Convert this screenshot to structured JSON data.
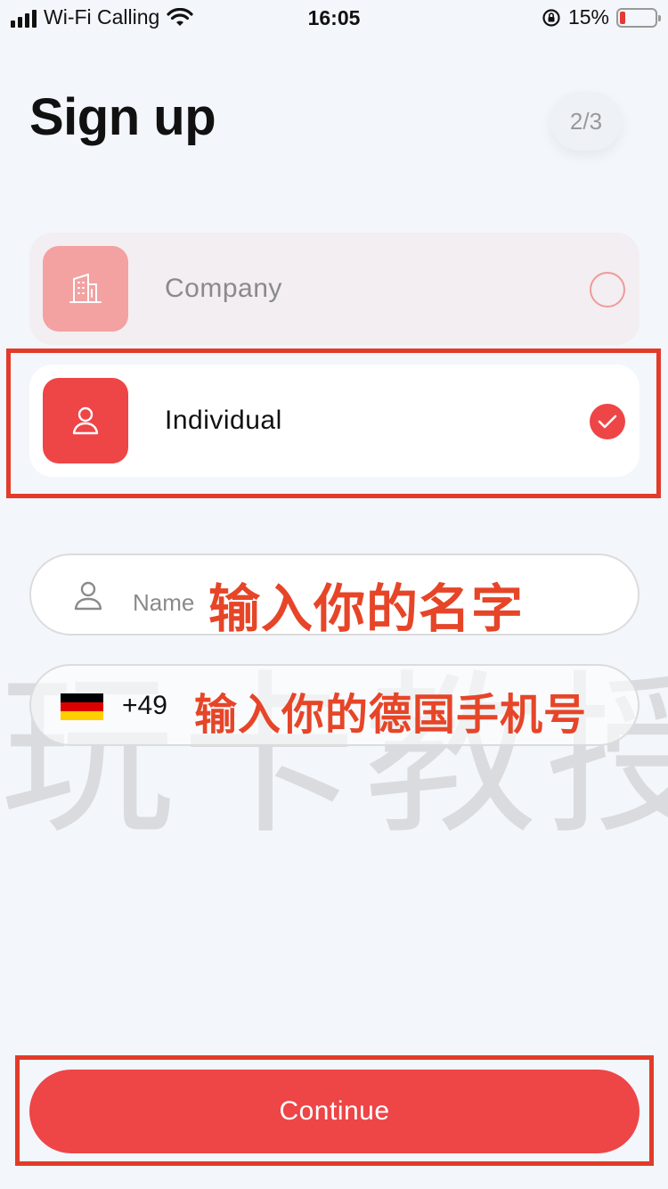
{
  "status_bar": {
    "carrier": "Wi-Fi Calling",
    "time": "16:05",
    "battery": "15%",
    "battery_level": 0.15,
    "icons": [
      "signal-bars-icon",
      "wifi-icon",
      "rotation-lock-icon",
      "battery-icon"
    ]
  },
  "header": {
    "title": "Sign up",
    "step": "2/3"
  },
  "account_types": [
    {
      "label": "Company",
      "icon": "building-icon",
      "selected": false
    },
    {
      "label": "Individual",
      "icon": "person-icon",
      "selected": true
    }
  ],
  "form": {
    "name_placeholder": "Name",
    "phone_dial_code": "+49",
    "phone_country_flag": "germany-flag"
  },
  "annotations": {
    "name_hint": "输入你的名字",
    "phone_hint": "输入你的德国手机号"
  },
  "watermark": "玩卡教授",
  "continue_label": "Continue",
  "colors": {
    "accent": "#ee4547",
    "accent_light": "#f3a1a1",
    "annotation": "#e23b2a",
    "background": "#f3f6fb"
  }
}
